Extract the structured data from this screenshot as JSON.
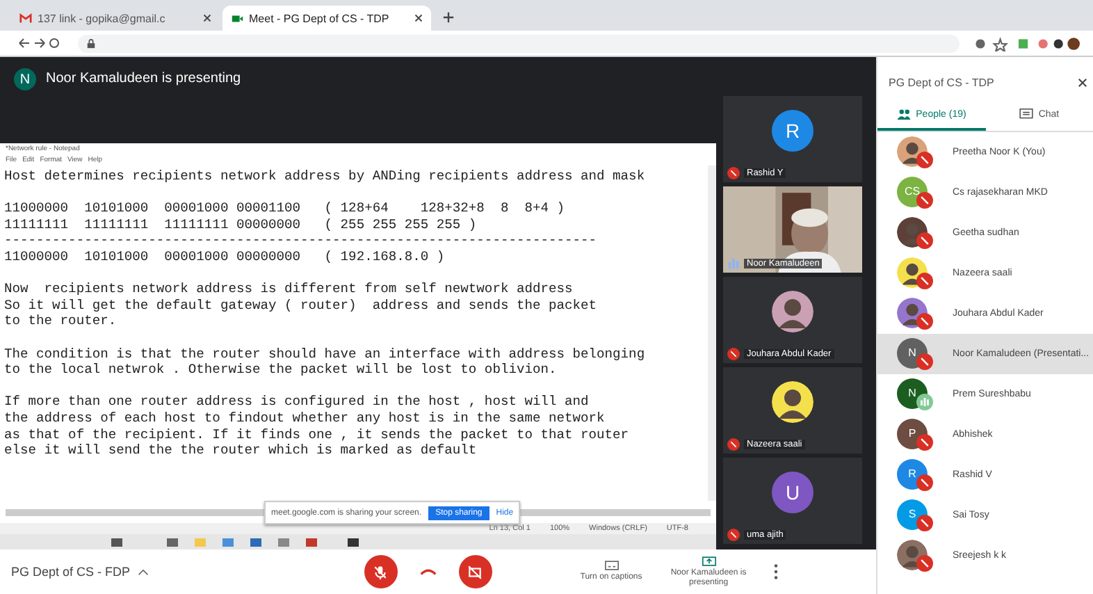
{
  "browser": {
    "tabs": [
      {
        "title": "137 link - gopika@gmail.c",
        "kind": "mail",
        "selected": false
      },
      {
        "title": "Meet - PG Dept of CS - TDP",
        "kind": "meet",
        "selected": true
      }
    ]
  },
  "banner": {
    "initial": "N",
    "text": "Noor Kamaludeen is presenting"
  },
  "notepad": {
    "title": "*Network rule - Notepad",
    "menu": [
      "File",
      "Edit",
      "Format",
      "View",
      "Help"
    ],
    "paragraphs": [
      [
        "Host determines recipients network address by ANDing recipients address and mask"
      ],
      [
        "11000000  10101000  00001000 00001100   ( 128+64    128+32+8  8  8+4 )",
        "11111111  11111111  11111111 00000000   ( 255 255 255 255 )",
        "--------------------------------------------------------------------------",
        "11000000  10101000  00001000 00000000   ( 192.168.8.0 )"
      ],
      [
        "Now  recipients network address is different from self newtwork address",
        "So it will get the default gateway ( router)  address and sends the packet",
        "to the router."
      ],
      [
        "The condition is that the router should have an interface with address belonging",
        "to the local netwrok . Otherwise the packet will be lost to oblivion."
      ],
      [
        "If more than one router address is configured in the host , host will and",
        "the address of each host to findout whether any host is in the same network",
        "as that of the recipient. If it finds one , it sends the packet to that router",
        "else it will send the the router which is marked as default"
      ]
    ],
    "sharing_text": "meet.google.com is sharing your screen.",
    "stop": "Stop sharing",
    "hide": "Hide",
    "status": [
      "Ln 13, Col 1",
      "100%",
      "Windows (CRLF)",
      "UTF-8"
    ]
  },
  "tiles": [
    {
      "name": "Rashid Y",
      "kind": "avatar",
      "initial": "R",
      "color": "#1e88e5",
      "muted": true
    },
    {
      "name": "Noor Kamaludeen",
      "kind": "video",
      "muted": false
    },
    {
      "name": "Jouhara Abdul Kader",
      "color": "#c9a0b4",
      "muted": true
    },
    {
      "name": "Nazeera saali",
      "color": "#f4e04d",
      "muted": true
    },
    {
      "name": "uma ajith",
      "kind": "avatar",
      "initial": "U",
      "color": "#7e57c2",
      "muted": true
    }
  ],
  "bottom": {
    "meeting": "PG Dept of CS - FDP",
    "captions": "Turn on captions",
    "presenting": "Noor Kamaludeen is presenting"
  },
  "panel": {
    "title": "PG Dept of CS - TDP",
    "tabs": [
      {
        "label": "People (19)",
        "kind": "people",
        "selected": true
      },
      {
        "label": "Chat",
        "kind": "chat",
        "selected": false
      }
    ],
    "people": [
      {
        "name": "Preetha Noor K (You)",
        "color": "#d9a27a",
        "muted": true,
        "selected": false
      },
      {
        "name": "Cs rajasekharan MKD",
        "kind": "avatar",
        "initial": "CS",
        "color": "#7cb342",
        "muted": true,
        "selected": false
      },
      {
        "name": "Geetha sudhan",
        "color": "#5d4037",
        "muted": true,
        "selected": false
      },
      {
        "name": "Nazeera saali",
        "color": "#f4e04d",
        "muted": true,
        "selected": false
      },
      {
        "name": "Jouhara Abdul Kader",
        "color": "#9575cd",
        "muted": true,
        "selected": false
      },
      {
        "name": "Noor Kamaludeen (Presentati...",
        "kind": "avatar",
        "initial": "N",
        "color": "#616161",
        "muted": true,
        "selected": true
      },
      {
        "name": "Prem Sureshbabu",
        "kind": "avatar",
        "initial": "N",
        "color": "#1b5e20",
        "muted": false,
        "selected": false
      },
      {
        "name": "Abhishek",
        "kind": "avatar",
        "initial": "P",
        "color": "#6d4c41",
        "muted": true,
        "selected": false
      },
      {
        "name": "Rashid V",
        "kind": "avatar",
        "initial": "R",
        "color": "#1e88e5",
        "muted": true,
        "selected": false
      },
      {
        "name": "Sai Tosy",
        "kind": "avatar",
        "initial": "S",
        "color": "#039be5",
        "muted": true,
        "selected": false
      },
      {
        "name": "Sreejesh k k",
        "color": "#8d6e63",
        "muted": true,
        "selected": false
      }
    ]
  }
}
